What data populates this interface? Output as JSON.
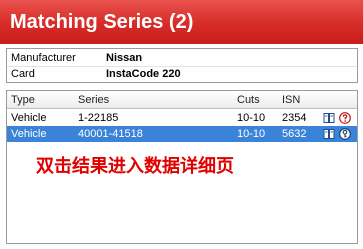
{
  "window": {
    "title": "Matching Series (2)"
  },
  "info": [
    {
      "label": "Manufacturer",
      "value": "Nissan"
    },
    {
      "label": "Card",
      "value": "InstaCode 220"
    }
  ],
  "table": {
    "columns": [
      "Type",
      "Series",
      "Cuts",
      "ISN"
    ],
    "rows": [
      {
        "type": "Vehicle",
        "series": "1-22185",
        "cuts": "10-10",
        "isn": "2354",
        "selected": false
      },
      {
        "type": "Vehicle",
        "series": "40001-41518",
        "cuts": "10-10",
        "isn": "5632",
        "selected": true
      }
    ]
  },
  "annotation": "双击结果进入数据详细页",
  "icons": [
    "book-icon",
    "help-icon",
    "book-icon",
    "key-icon"
  ],
  "colors": {
    "title_bar": "#d72b27",
    "selection": "#3a83d8",
    "annotation": "#e10000"
  }
}
